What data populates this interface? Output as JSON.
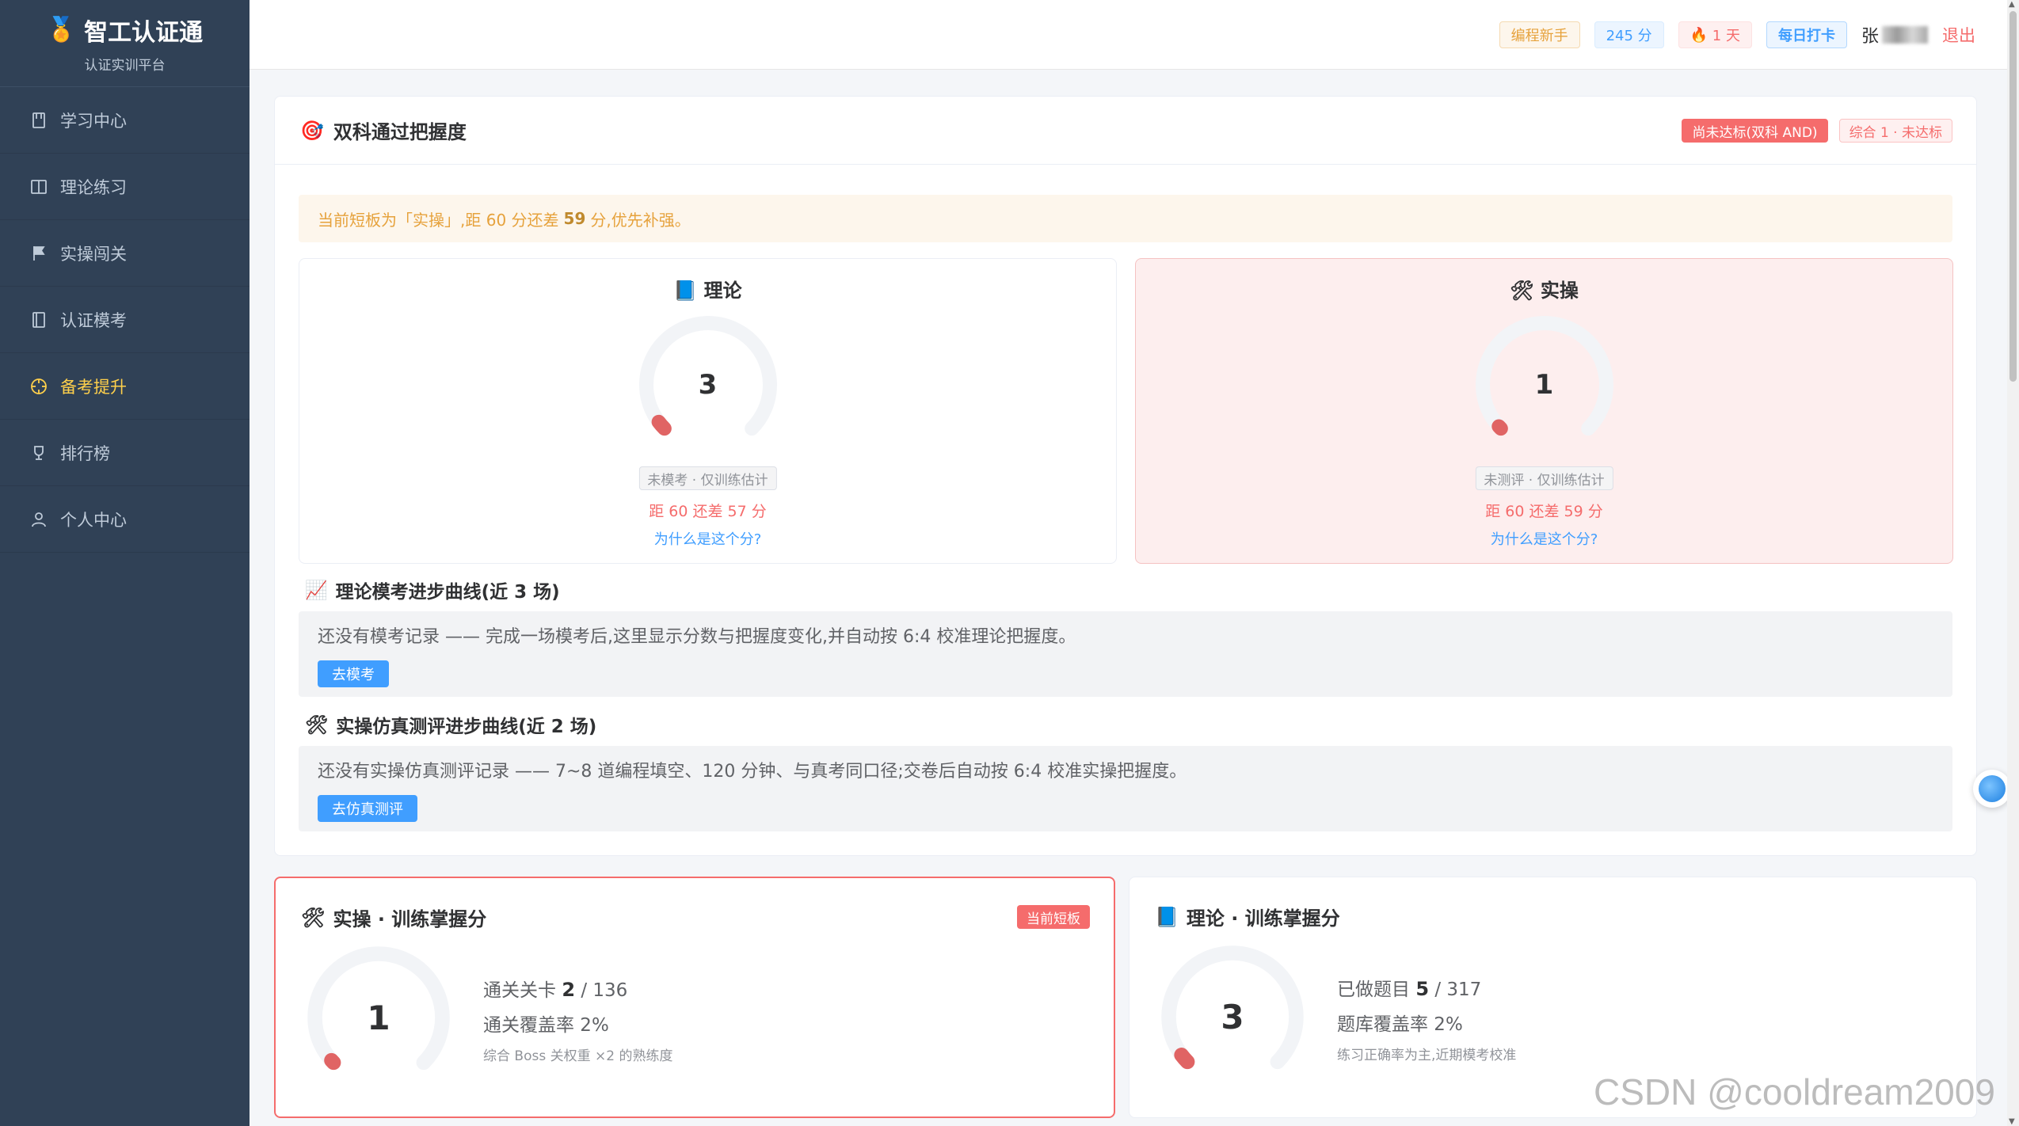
{
  "brand": {
    "title": "智工认证通",
    "subtitle": "认证实训平台",
    "icon": "medal-icon"
  },
  "nav": [
    {
      "label": "学习中心",
      "icon": "book-icon",
      "active": false
    },
    {
      "label": "理论练习",
      "icon": "open-book-icon",
      "active": false
    },
    {
      "label": "实操闯关",
      "icon": "flag-icon",
      "active": false
    },
    {
      "label": "认证模考",
      "icon": "notebook-icon",
      "active": false
    },
    {
      "label": "备考提升",
      "icon": "target-icon",
      "active": true
    },
    {
      "label": "排行榜",
      "icon": "trophy-icon",
      "active": false
    },
    {
      "label": "个人中心",
      "icon": "user-icon",
      "active": false
    }
  ],
  "header": {
    "level_tag": "编程新手",
    "score_tag": "245 分",
    "streak_tag": "1 天",
    "checkin_button": "每日打卡",
    "user_name": "张",
    "logout": "退出"
  },
  "mastery": {
    "title": "双科通过把握度",
    "status_tag": "尚未达标(双科 AND)",
    "summary_tag": "综合 1 · 未达标",
    "alert_prefix": "当前短板为「实操」,距 60 分还差",
    "alert_number": "59",
    "alert_suffix": "分,优先补强。",
    "theory": {
      "title": "理论",
      "score": "3",
      "score_value": 3,
      "est_tag": "未模考 · 仅训练估计",
      "gap": "距 60 还差 57 分",
      "why": "为什么是这个分?"
    },
    "practice": {
      "title": "实操",
      "score": "1",
      "score_value": 1,
      "est_tag": "未测评 · 仅训练估计",
      "gap": "距 60 还差 59 分",
      "why": "为什么是这个分?"
    }
  },
  "theory_curve": {
    "title": "理论模考进步曲线(近 3 场)",
    "empty_text": "还没有模考记录 —— 完成一场模考后,这里显示分数与把握度变化,并自动按 6:4 校准理论把握度。",
    "button": "去模考"
  },
  "practice_curve": {
    "title": "实操仿真测评进步曲线(近 2 场)",
    "empty_text": "还没有实操仿真测评记录 —— 7~8 道编程填空、120 分钟、与真考同口径;交卷后自动按 6:4 校准实操把握度。",
    "button": "去仿真测评"
  },
  "practice_training": {
    "title": "实操 · 训练掌握分",
    "tag": "当前短板",
    "score": "1",
    "score_value": 1,
    "line1_label": "通关关卡",
    "line1_value": "2",
    "line1_total": "/ 136",
    "line2": "通关覆盖率 2%",
    "note": "综合 Boss 关权重 ×2 的熟练度"
  },
  "theory_training": {
    "title": "理论 · 训练掌握分",
    "score": "3",
    "score_value": 3,
    "line1_label": "已做题目",
    "line1_value": "5",
    "line1_total": "/ 317",
    "line2": "题库覆盖率 2%",
    "note": "练习正确率为主,近期模考校准"
  },
  "watermark": "CSDN @cooldream2009",
  "colors": {
    "sidebar": "#304156",
    "active": "#ffd04b",
    "primary": "#409eff",
    "danger": "#f56c6c",
    "warning": "#e6a23c"
  }
}
